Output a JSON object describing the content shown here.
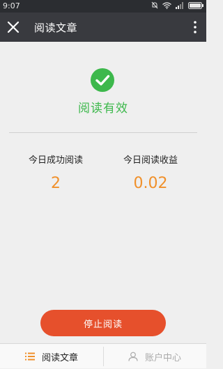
{
  "status_bar": {
    "time": "9:07",
    "icons": [
      "mute-icon",
      "wifi-icon",
      "signal-icon",
      "battery-icon"
    ]
  },
  "app_bar": {
    "title": "阅读文章",
    "close_icon": "close-icon",
    "more_icon": "more-vertical-icon"
  },
  "result": {
    "icon": "check-circle-icon",
    "text": "阅读有效",
    "accent_color": "#3db84c"
  },
  "stats": {
    "today_success_label": "今日成功阅读",
    "today_success_value": "2",
    "today_earnings_label": "今日阅读收益",
    "today_earnings_value": "0.02",
    "value_color": "#f0902a"
  },
  "stop_button_label": "停止阅读",
  "stop_button_color": "#e6502c",
  "tabs": [
    {
      "label": "阅读文章",
      "icon": "list-icon",
      "active": true
    },
    {
      "label": "账户中心",
      "icon": "user-icon",
      "active": false
    }
  ]
}
